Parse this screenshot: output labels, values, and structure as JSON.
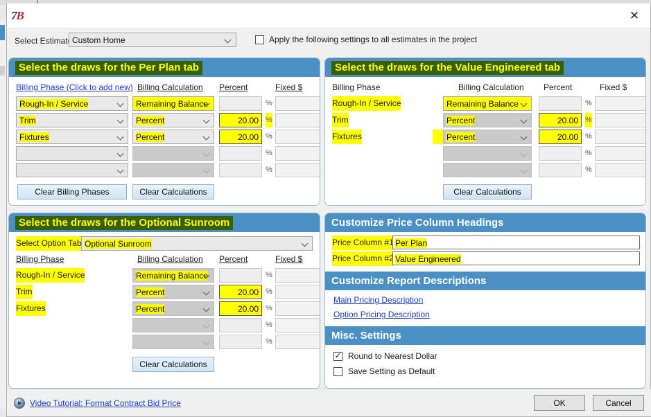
{
  "window": {
    "logo_text_1": "7",
    "logo_text_2": "B",
    "close_icon": "close-icon"
  },
  "toolbar": {
    "estimate_label": "Select Estimate:",
    "estimate_value": "Custom Home",
    "apply_all_label": "Apply the following settings to all estimates in the project",
    "apply_all_checked": ""
  },
  "columns": {
    "billing_phase_link": "Billing Phase (Click to add new)",
    "billing_phase": "Billing Phase",
    "billing_calculation": "Billing Calculation",
    "percent": "Percent",
    "fixed": "Fixed $",
    "percent_sign": "%"
  },
  "per_plan_panel": {
    "title": "Select the draws for the Per Plan tab",
    "rows": [
      {
        "phase": "Rough-In / Service",
        "calc": "Remaining Balance",
        "percent": "",
        "fixed": ""
      },
      {
        "phase": "Trim",
        "calc": "Percent",
        "percent": "20.00",
        "fixed": ""
      },
      {
        "phase": "Fixtures",
        "calc": "Percent",
        "percent": "20.00",
        "fixed": ""
      },
      {
        "phase": "",
        "calc": "",
        "percent": "",
        "fixed": ""
      },
      {
        "phase": "",
        "calc": "",
        "percent": "",
        "fixed": ""
      }
    ],
    "clear_phases_label": "Clear Billing Phases",
    "clear_calcs_label": "Clear Calculations"
  },
  "value_eng_panel": {
    "title": "Select the draws for the Value Engineered tab",
    "rows": [
      {
        "phase": "Rough-In / Service",
        "calc": "Remaining Balance",
        "percent": "",
        "fixed": ""
      },
      {
        "phase": "Trim",
        "calc": "Percent",
        "percent": "20.00",
        "fixed": ""
      },
      {
        "phase": "Fixtures",
        "calc": "Percent",
        "percent": "20.00",
        "fixed": ""
      },
      {
        "phase": "",
        "calc": "",
        "percent": "",
        "fixed": ""
      },
      {
        "phase": "",
        "calc": "",
        "percent": "",
        "fixed": ""
      }
    ],
    "clear_calcs_label": "Clear Calculations"
  },
  "sunroom_panel": {
    "title": "Select the draws for the Optional Sunroom",
    "option_tab_label": "Select Option Tab:",
    "option_tab_value": "Optional Sunroom",
    "rows": [
      {
        "phase": "Rough-In / Service",
        "calc": "Remaining Balance",
        "percent": "",
        "fixed": ""
      },
      {
        "phase": "Trim",
        "calc": "Percent",
        "percent": "20.00",
        "fixed": ""
      },
      {
        "phase": "Fixtures",
        "calc": "Percent",
        "percent": "20.00",
        "fixed": ""
      },
      {
        "phase": "",
        "calc": "",
        "percent": "",
        "fixed": ""
      },
      {
        "phase": "",
        "calc": "",
        "percent": "",
        "fixed": ""
      }
    ],
    "clear_calcs_label": "Clear Calculations"
  },
  "price_columns": {
    "title": "Customize Price Column Headings",
    "col1_label": "Price Column #1",
    "col1_value": "Per Plan",
    "col2_label": "Price Column #2",
    "col2_value": "Value Engineered"
  },
  "report_descriptions": {
    "title": "Customize Report Descriptions",
    "main_link": "Main Pricing Description",
    "option_link": "Option Pricing Description"
  },
  "misc_settings": {
    "title": "Misc. Settings",
    "round_label": "Round to Nearest Dollar",
    "round_checked": "✓",
    "save_label": "Save Setting as Default",
    "save_checked": ""
  },
  "footer": {
    "video_link": "Video Tutorial: Format Contract Bid Price",
    "ok_label": "OK",
    "cancel_label": "Cancel"
  },
  "colors": {
    "panel_header_blue": "#4a90c4",
    "header_text_green_bg": "#386000",
    "header_text_yellow": "#ffff00",
    "highlight_yellow": "#ffff00",
    "link_blue": "#1b3fbf"
  }
}
